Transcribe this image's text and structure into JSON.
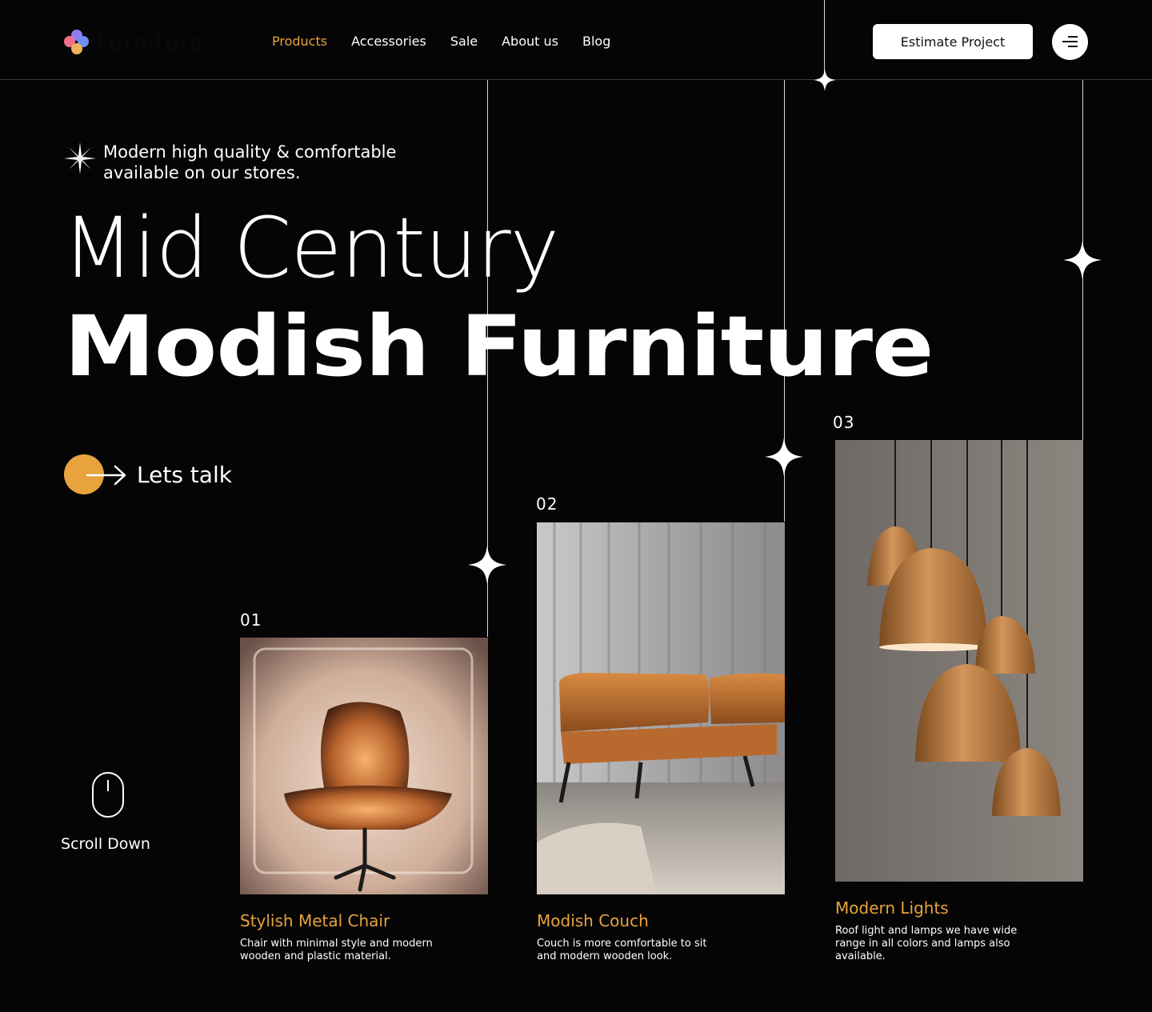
{
  "brand": {
    "name": "Furniture"
  },
  "nav": {
    "items": [
      {
        "label": "Products",
        "active": true
      },
      {
        "label": "Accessories"
      },
      {
        "label": "Sale"
      },
      {
        "label": "About us"
      },
      {
        "label": "Blog"
      }
    ],
    "cta_label": "Estimate Project"
  },
  "hero": {
    "tagline_line1": "Modern high quality & comfortable",
    "tagline_line2": "available on our stores.",
    "title_line1": "Mid Century",
    "title_line2": "Modish Furniture",
    "cta_label": "Lets talk"
  },
  "scroll": {
    "label": "Scroll Down"
  },
  "products": [
    {
      "number": "01",
      "title": "Stylish Metal Chair",
      "desc_line1": "Chair with minimal style and modern",
      "desc_line2": "wooden and plastic material."
    },
    {
      "number": "02",
      "title": "Modish Couch",
      "desc_line1": "Couch is more comfortable to sit",
      "desc_line2": "and modern wooden look."
    },
    {
      "number": "03",
      "title": "Modern Lights",
      "desc_line1": "Roof light and lamps we have wide",
      "desc_line2": "range in all colors and lamps also",
      "desc_line3": "available."
    }
  ],
  "colors": {
    "accent": "#e8a33d",
    "background": "#050505",
    "text": "#ffffff"
  }
}
